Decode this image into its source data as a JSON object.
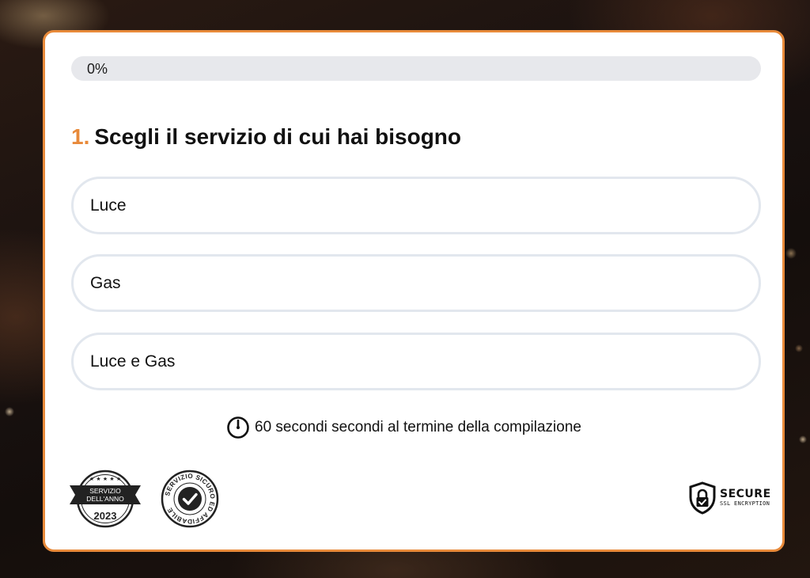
{
  "progress": {
    "label": "0%",
    "value": 0
  },
  "question": {
    "number": "1.",
    "text": "Scegli il servizio di cui hai bisogno"
  },
  "options": [
    {
      "label": "Luce"
    },
    {
      "label": "Gas"
    },
    {
      "label": "Luce e Gas"
    }
  ],
  "timer": {
    "icon": "stopwatch-icon",
    "text": "60 secondi secondi al termine della compilazione"
  },
  "badges": {
    "servizio_anno": {
      "line1": "SERVIZIO",
      "line2": "DELL'ANNO",
      "year": "2023"
    },
    "affidabile": {
      "text": "SERVIZIO SICURO ED AFFIDABILE"
    },
    "secure": {
      "title": "SECURE",
      "subtitle": "SSL ENCRYPTION"
    }
  },
  "colors": {
    "accent": "#e88a3a",
    "option_border": "#e2e7ee",
    "progress_track": "#e7e8ec"
  }
}
